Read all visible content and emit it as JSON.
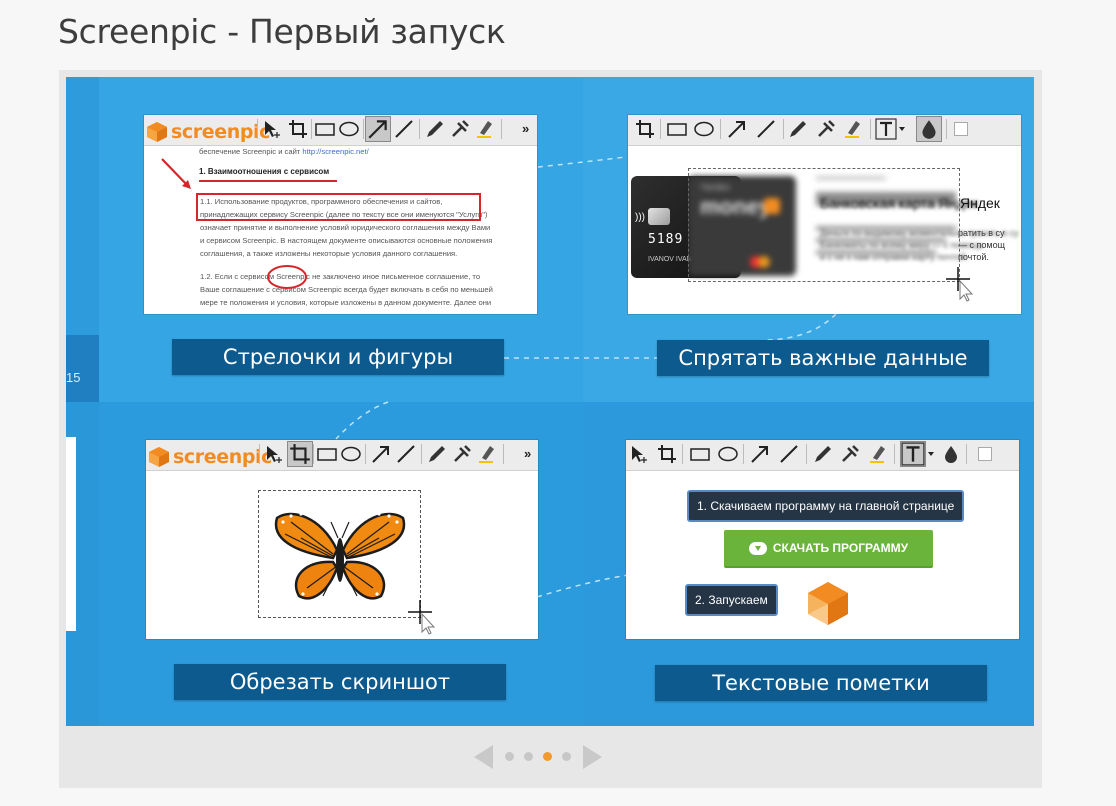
{
  "page": {
    "title": "Screenpic - Первый запуск"
  },
  "colors": {
    "stage": "#2f9fdf",
    "caption": "#0d5a8f",
    "accent": "#f28c22",
    "download": "#6ab43c"
  },
  "left_strip": {
    "number": "15"
  },
  "slides": [
    {
      "caption": "Стрелочки и фигуры",
      "logo": "screenpic",
      "doc": {
        "line0": "беспечение Screenpic и сайт ",
        "line0_link": "http://screenpic.net/",
        "heading": "1. Взаимоотношения с сервисом",
        "p1": [
          "1.1. Использование продуктов, программного обеспечения и сайтов,",
          "принадлежащих сервису Screenpic (далее по тексту все они именуются \"Услуги\")",
          "означает принятие и выполнение условий юридического соглашения между Вами",
          "и сервисом Screenpic. В настоящем документе описываются основные положения",
          "соглашения, а также изложены некоторые условия данного соглашения."
        ],
        "p2": [
          "1.2. Если с сервисом Screenpic не заключено иное письменное соглашение, то",
          "Ваше соглашение с сервисом Screenpic всегда будет включать в себя по меньшей",
          "мере те положения и условия, которые изложены в данном документе. Далее они"
        ]
      }
    },
    {
      "caption": "Спрятать важные данные",
      "card": {
        "number": "5189 2",
        "holder": "IVANOV IVAN",
        "brand_small": "Yandex",
        "brand": "money",
        "title": "Банковская карта Яндек",
        "text": [
          "Деньги по-видимому моментально тратить в су",
          "Банкоматы по всему миру — с помощь",
          "и с не к нам отправки карту почтой."
        ]
      }
    },
    {
      "caption": "Обрезать скриншот",
      "logo": "screenpic"
    },
    {
      "caption": "Текстовые пометки",
      "tip1": "1. Скачиваем программу на главной странице",
      "download_button": "СКАЧАТЬ ПРОГРАММУ",
      "tip2": "2. Запускаем"
    }
  ],
  "pager": {
    "total": 4,
    "active_index": 2
  },
  "icons": [
    "cursor-icon",
    "crop-icon",
    "rectangle-icon",
    "ellipse-icon",
    "arrow-icon",
    "line-icon",
    "pencil-icon",
    "blur-icon",
    "marker-icon",
    "text-icon",
    "drop-icon",
    "color-picker-icon",
    "more-icon"
  ]
}
